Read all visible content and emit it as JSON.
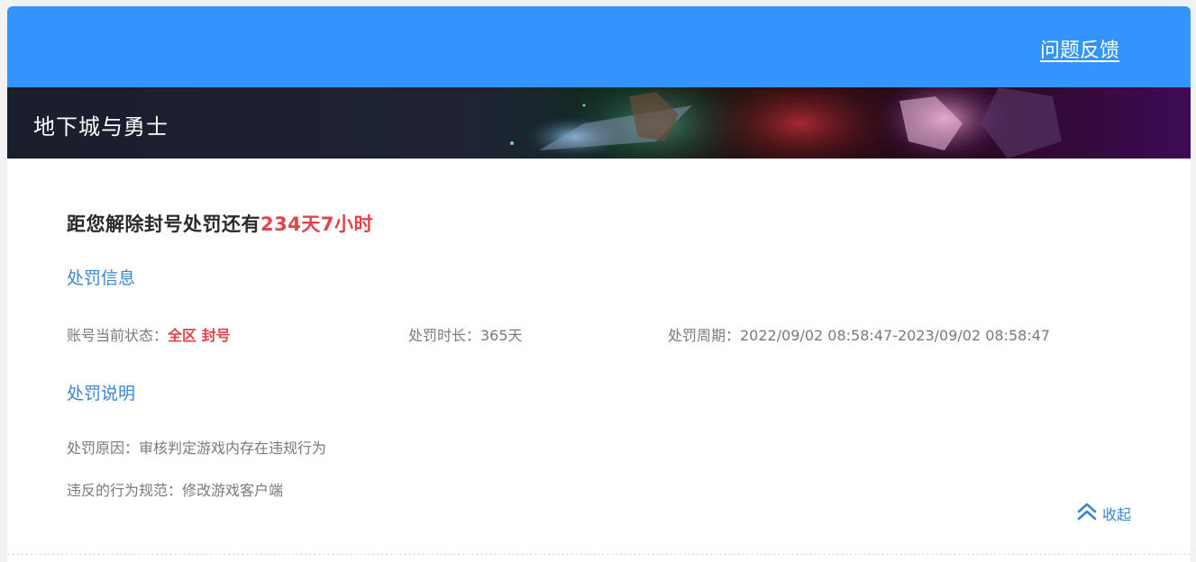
{
  "header": {
    "feedback_label": "问题反馈",
    "bar_color": "#3394fd"
  },
  "banner": {
    "game_title": "地下城与勇士"
  },
  "countdown": {
    "prefix": "距您解除封号处罚还有",
    "remaining": "234天7小时"
  },
  "penalty_info": {
    "title": "处罚信息",
    "status_label": "账号当前状态：",
    "status_value": "全区 封号",
    "duration": "处罚时长：365天",
    "period": "处罚周期：2022/09/02 08:58:47-2023/09/02 08:58:47"
  },
  "penalty_explain": {
    "title": "处罚说明",
    "reason": "处罚原因：审核判定游戏内存在违规行为",
    "violation": "违反的行为规范：修改游戏客户端"
  },
  "collapse": {
    "label": "收起",
    "icon": "double-chevron-up-icon"
  },
  "colors": {
    "accent": "#3a86d6",
    "alert": "#e2434b"
  }
}
